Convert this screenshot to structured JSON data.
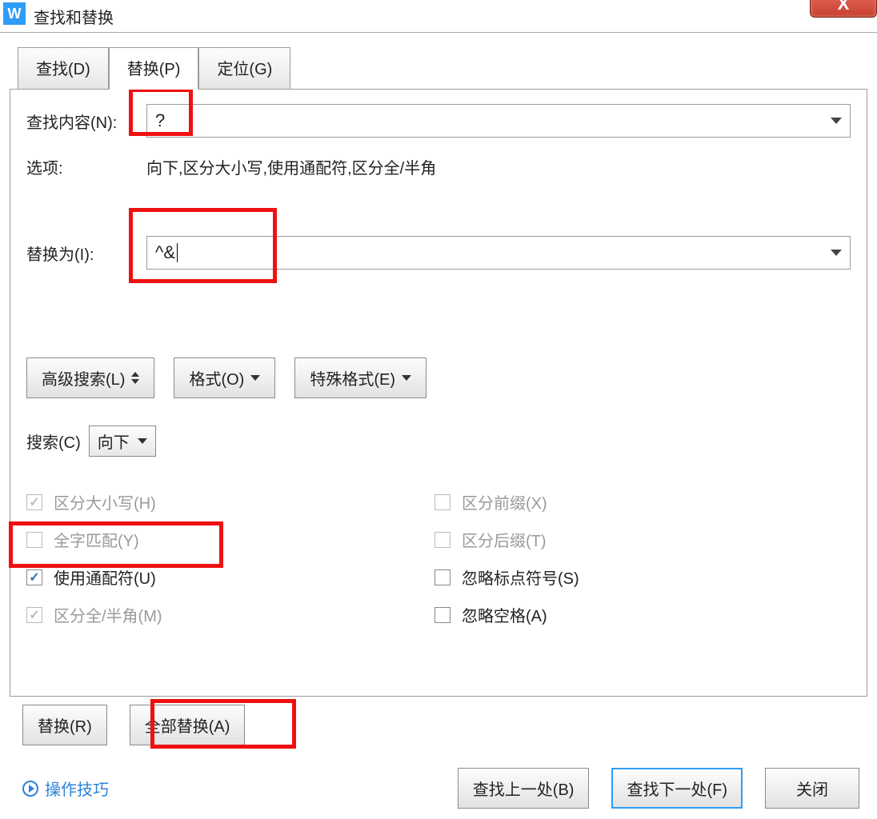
{
  "window": {
    "title": "查找和替换",
    "close_x": "X"
  },
  "tabs": {
    "find": "查找(D)",
    "replace": "替换(P)",
    "goto": "定位(G)"
  },
  "labels": {
    "find_what": "查找内容(N):",
    "options": "选项:",
    "replace_with": "替换为(I):",
    "search": "搜索(C)"
  },
  "values": {
    "find_what": "?",
    "options_text": "向下,区分大小写,使用通配符,区分全/半角",
    "replace_with": "^& ",
    "search_direction": "向下"
  },
  "buttons": {
    "advanced": "高级搜索(L)",
    "format": "格式(O)",
    "special": "特殊格式(E)",
    "replace": "替换(R)",
    "replace_all": "全部替换(A)",
    "find_prev": "查找上一处(B)",
    "find_next": "查找下一处(F)",
    "close": "关闭"
  },
  "checks": {
    "match_case": "区分大小写(H)",
    "whole_word": "全字匹配(Y)",
    "wildcards": "使用通配符(U)",
    "full_half": "区分全/半角(M)",
    "prefix": "区分前缀(X)",
    "suffix": "区分后缀(T)",
    "ignore_punct": "忽略标点符号(S)",
    "ignore_space": "忽略空格(A)"
  },
  "tips": "操作技巧"
}
